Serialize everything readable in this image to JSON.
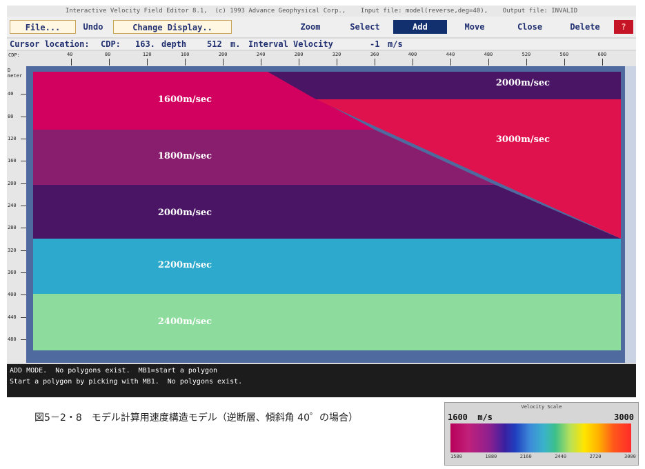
{
  "window": {
    "title": "Interactive Velocity Field Editor 8.1,  (c) 1993 Advance Geophysical Corp.,    Input file: model(reverse,deg=40),    Output file: INVALID"
  },
  "menu": {
    "file": "File...",
    "undo": "Undo",
    "change_display": "Change Display..",
    "zoom": "Zoom",
    "select": "Select",
    "add": "Add",
    "move": "Move",
    "close": "Close",
    "delete": "Delete",
    "delete_flag": "?"
  },
  "cursor": {
    "label": "Cursor location:",
    "cdp_label": "CDP:",
    "cdp_value": "163.",
    "depth_label": "depth",
    "depth_value": "512",
    "depth_unit": "m.",
    "velocity_label": "Interval Velocity",
    "velocity_value": "-1",
    "velocity_unit": "m/s"
  },
  "ruler": {
    "top_axis_name": "CDP:",
    "top_ticks": [
      "40",
      "80",
      "120",
      "160",
      "200",
      "240",
      "280",
      "320",
      "360",
      "400",
      "440",
      "480",
      "520",
      "560",
      "600"
    ],
    "left_axis_name": "D\nmeter",
    "left_ticks": [
      "40",
      "80",
      "120",
      "160",
      "200",
      "240",
      "280",
      "320",
      "360",
      "400",
      "440",
      "480"
    ]
  },
  "model": {
    "cdp_range": [
      0,
      620
    ],
    "depth_range": [
      0,
      500
    ],
    "layers": [
      {
        "label": "1600m/sec",
        "color": "#d2015f"
      },
      {
        "label": "1800m/sec",
        "color": "#8a1e6e"
      },
      {
        "label": "2000m/sec",
        "color": "#4a1565"
      },
      {
        "label": "2200m/sec",
        "color": "#2ca9cc"
      },
      {
        "label": "2400m/sec",
        "color": "#8edc9d"
      },
      {
        "label": "2000m/sec",
        "color": "#4a1565"
      },
      {
        "label": "3000m/sec",
        "color": "#e0124e"
      }
    ]
  },
  "messages": {
    "line1": "ADD MODE.  No polygons exist.  MB1=start a polygon",
    "line2": "Start a polygon by picking with MB1.  No polygons exist."
  },
  "caption": "図5－2・8　モデル計算用速度構造モデル（逆断層、傾斜角 40゜の場合）",
  "velocity_scale": {
    "title": "Velocity Scale",
    "min_label": "1600",
    "unit": "m/s",
    "max_label": "3000",
    "ticks": [
      "1580",
      "1880",
      "2160",
      "2440",
      "2720",
      "3000"
    ]
  }
}
